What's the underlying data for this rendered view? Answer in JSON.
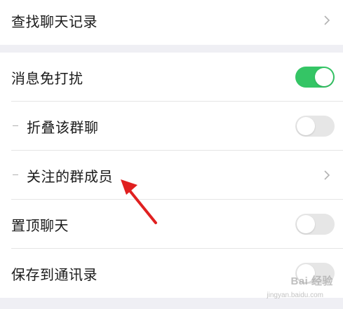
{
  "settings": {
    "search_history": {
      "label": "查找聊天记录"
    },
    "items": [
      {
        "label": "消息免打扰",
        "toggle": "on"
      },
      {
        "label": "折叠该群聊",
        "toggle": "off",
        "sub": true
      },
      {
        "label": "关注的群成员",
        "chevron": true,
        "sub": true
      },
      {
        "label": "置顶聊天",
        "toggle": "off"
      },
      {
        "label": "保存到通讯录",
        "toggle": "off"
      }
    ]
  },
  "colors": {
    "toggle_on": "#34c565",
    "toggle_off": "#e6e6e6",
    "annotation_arrow": "#e02020"
  },
  "watermark": {
    "brand": "Bai 经验",
    "url": "jingyan.baidu.com"
  }
}
